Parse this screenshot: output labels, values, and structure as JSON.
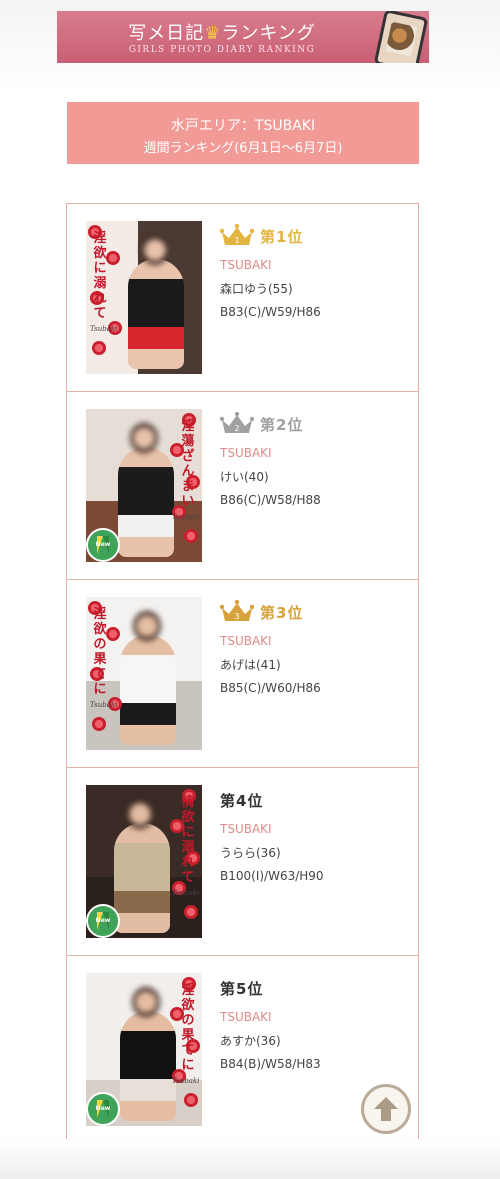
{
  "banner": {
    "title_a": "写メ日記",
    "crown": "♛",
    "title_b": "ランキング",
    "subtitle": "GIRLS PHOTO DIARY RANKING"
  },
  "area": {
    "title": "水戸エリア：TSUBAKI",
    "period": "週間ランキング(6月1日〜6月7日)"
  },
  "ranking": [
    {
      "rank_label": "第1位",
      "crown": "gold",
      "shop": "TSUBAKI",
      "name": "森口ゆう(55)",
      "size": "B83(C)/W59/H86",
      "new": false,
      "vtext": "淫欲に溺れて",
      "rank_num": "1"
    },
    {
      "rank_label": "第2位",
      "crown": "silver",
      "shop": "TSUBAKI",
      "name": "けい(40)",
      "size": "B86(C)/W58/H88",
      "new": true,
      "vtext": "淫蕩ざんまい",
      "rank_num": "2"
    },
    {
      "rank_label": "第3位",
      "crown": "bronze",
      "shop": "TSUBAKI",
      "name": "あげは(41)",
      "size": "B85(C)/W60/H86",
      "new": false,
      "vtext": "淫欲の果てに",
      "rank_num": "3"
    },
    {
      "rank_label": "第4位",
      "crown": "none",
      "shop": "TSUBAKI",
      "name": "うらら(36)",
      "size": "B100(I)/W63/H90",
      "new": true,
      "vtext": "情欲に溺れて"
    },
    {
      "rank_label": "第5位",
      "crown": "none",
      "shop": "TSUBAKI",
      "name": "あすか(36)",
      "size": "B84(B)/W58/H83",
      "new": true,
      "vtext": "淫欲の果てに"
    }
  ],
  "thumb_brand": "Tsubaki",
  "new_badge_text": "New",
  "colors": {
    "accent": "#f19a96",
    "gold": "#e1b540",
    "silver": "#a0a0a0",
    "bronze": "#d6a23c",
    "shop": "#e08a86"
  },
  "icons": {
    "scroll_top": "arrow-up-icon",
    "crown": "crown-icon"
  }
}
